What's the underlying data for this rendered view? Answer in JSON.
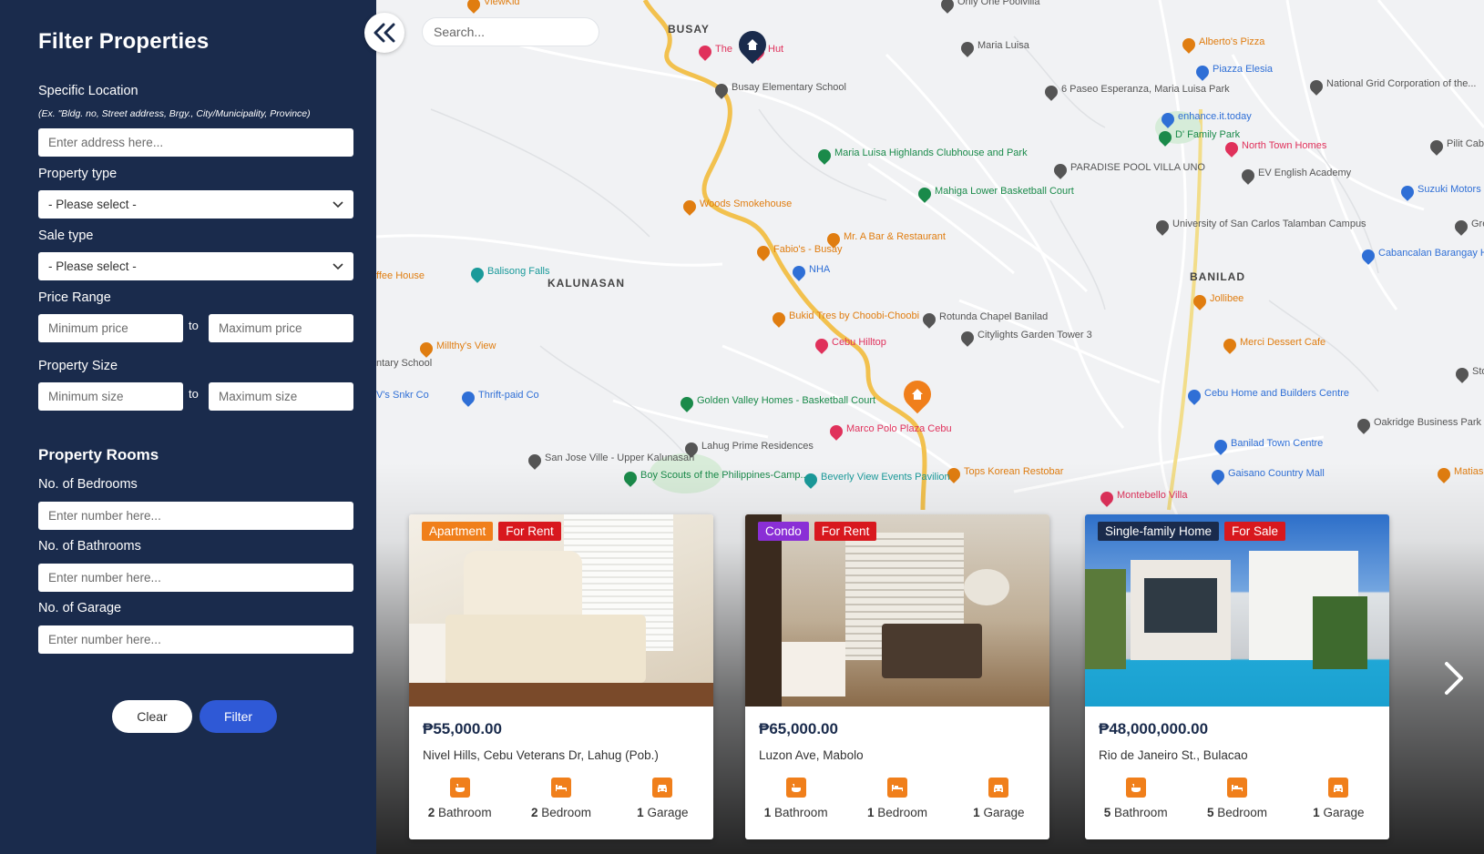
{
  "sidebar": {
    "title": "Filter Properties",
    "location": {
      "label": "Specific Location",
      "hint": "(Ex. \"Bldg. no, Street address, Brgy., City/Municipality, Province)",
      "placeholder": "Enter address here..."
    },
    "property_type": {
      "label": "Property type",
      "value": "- Please select -"
    },
    "sale_type": {
      "label": "Sale type",
      "value": "- Please select -"
    },
    "price_range": {
      "label": "Price Range",
      "min_placeholder": "Minimum price",
      "max_placeholder": "Maximum price",
      "to": "to"
    },
    "property_size": {
      "label": "Property Size",
      "min_placeholder": "Minimum size",
      "max_placeholder": "Maximum size",
      "to": "to"
    },
    "rooms_title": "Property Rooms",
    "bedrooms": {
      "label": "No. of Bedrooms",
      "placeholder": "Enter number here..."
    },
    "bathrooms": {
      "label": "No. of Bathrooms",
      "placeholder": "Enter number here..."
    },
    "garage": {
      "label": "No. of Garage",
      "placeholder": "Enter number here..."
    },
    "clear_label": "Clear",
    "filter_label": "Filter",
    "collapse_icon": "double-chevron-left-icon"
  },
  "search": {
    "placeholder": "Search..."
  },
  "map": {
    "areas": [
      "BUSAY",
      "KALUNASAN",
      "BANILAD"
    ],
    "pois": [
      {
        "label": "ViewKid",
        "color": "#e07d10"
      },
      {
        "label": "Only One Poolvilla",
        "color": "#555"
      },
      {
        "label": "The",
        "color": "#e0315b"
      },
      {
        "label": "Hut",
        "color": "#e0315b"
      },
      {
        "label": "Maria Luisa",
        "color": "#555"
      },
      {
        "label": "Busay Elementary School",
        "color": "#555"
      },
      {
        "label": "6 Paseo Esperanza, Maria Luisa Park",
        "color": "#555"
      },
      {
        "label": "Alberto's Pizza",
        "color": "#e07d10"
      },
      {
        "label": "Piazza Elesia",
        "color": "#2f6fd6"
      },
      {
        "label": "National Grid Corporation of the...",
        "color": "#555"
      },
      {
        "label": "enhance.it.today",
        "color": "#2f6fd6"
      },
      {
        "label": "D' Family Park",
        "color": "#1a8a4a"
      },
      {
        "label": "North Town Homes",
        "color": "#e0315b"
      },
      {
        "label": "Pilit Cab",
        "color": "#555"
      },
      {
        "label": "Maria Luisa Highlands Clubhouse and Park",
        "color": "#1a8a4a"
      },
      {
        "label": "PARADISE POOL VILLA UNO",
        "color": "#555"
      },
      {
        "label": "EV English Academy",
        "color": "#555"
      },
      {
        "label": "Suzuki Motors",
        "color": "#2f6fd6"
      },
      {
        "label": "Mahiga Lower Basketball Court",
        "color": "#1a8a4a"
      },
      {
        "label": "Woods Smokehouse",
        "color": "#e07d10"
      },
      {
        "label": "University of San Carlos Talamban Campus",
        "color": "#555"
      },
      {
        "label": "Greenhi",
        "color": "#555"
      },
      {
        "label": "Fabio's - Busay",
        "color": "#e07d10"
      },
      {
        "label": "Mr. A Bar & Restaurant",
        "color": "#e07d10"
      },
      {
        "label": "Cabancalan Barangay Hall",
        "color": "#2f6fd6"
      },
      {
        "label": "ffee House",
        "color": "#e07d10"
      },
      {
        "label": "Balisong Falls",
        "color": "#1a9a9a"
      },
      {
        "label": "NHA",
        "color": "#2f6fd6"
      },
      {
        "label": "Jollibee",
        "color": "#e07d10"
      },
      {
        "label": "Bukid Tres by Choobi-Choobi",
        "color": "#e07d10"
      },
      {
        "label": "Rotunda Chapel Banilad",
        "color": "#555"
      },
      {
        "label": "Millthy's View",
        "color": "#e07d10"
      },
      {
        "label": "Cebu Hilltop",
        "color": "#e0315b"
      },
      {
        "label": "Citylights Garden Tower 3",
        "color": "#555"
      },
      {
        "label": "Merci Dessert Cafe",
        "color": "#e07d10"
      },
      {
        "label": "ntary School",
        "color": "#555"
      },
      {
        "label": "Sto. Niño Village",
        "color": "#555"
      },
      {
        "label": "V's Snkr Co",
        "color": "#2f6fd6"
      },
      {
        "label": "Thrift-paid Co",
        "color": "#2f6fd6"
      },
      {
        "label": "Cebu Home and Builders Centre",
        "color": "#2f6fd6"
      },
      {
        "label": "Golden Valley Homes - Basketball Court",
        "color": "#1a8a4a"
      },
      {
        "label": "Marco Polo Plaza Cebu",
        "color": "#e0315b"
      },
      {
        "label": "Oakridge Business Park",
        "color": "#555"
      },
      {
        "label": "Lahug Prime Residences",
        "color": "#555"
      },
      {
        "label": "Banilad Town Centre",
        "color": "#2f6fd6"
      },
      {
        "label": "San Jose Ville - Upper Kalunasan",
        "color": "#555"
      },
      {
        "label": "Tops Korean Restobar",
        "color": "#e07d10"
      },
      {
        "label": "Gaisano Country Mall",
        "color": "#2f6fd6"
      },
      {
        "label": "Matias BBQ",
        "color": "#e07d10"
      },
      {
        "label": "Boy Scouts of the Philippines-Camp...",
        "color": "#1a8a4a"
      },
      {
        "label": "Beverly View Events Pavilion",
        "color": "#1a9a9a"
      },
      {
        "label": "Montebello Villa",
        "color": "#e0315b"
      }
    ]
  },
  "listings": [
    {
      "type": "Apartment",
      "type_color": "#f07f1b",
      "status": "For Rent",
      "status_color": "#d8181e",
      "price": "₱55,000.00",
      "address": "Nivel Hills, Cebu Veterans Dr, Lahug (Pob.)",
      "bath_count": "2",
      "bath_label": "Bathroom",
      "bed_count": "2",
      "bed_label": "Bedroom",
      "garage_count": "1",
      "garage_label": "Garage"
    },
    {
      "type": "Condo",
      "type_color": "#8a2fd6",
      "status": "For Rent",
      "status_color": "#d8181e",
      "price": "₱65,000.00",
      "address": "Luzon Ave, Mabolo",
      "bath_count": "1",
      "bath_label": "Bathroom",
      "bed_count": "1",
      "bed_label": "Bedroom",
      "garage_count": "1",
      "garage_label": "Garage"
    },
    {
      "type": "Single-family Home",
      "type_color": "#1a2b4c",
      "status": "For Sale",
      "status_color": "#d8181e",
      "price": "₱48,000,000.00",
      "address": "Rio de Janeiro St., Bulacao",
      "bath_count": "5",
      "bath_label": "Bathroom",
      "bed_count": "5",
      "bed_label": "Bedroom",
      "garage_count": "1",
      "garage_label": "Garage"
    }
  ],
  "colors": {
    "sidebar_bg": "#1a2b4c",
    "accent": "#2f59d6",
    "feature_icon": "#f07f1b"
  }
}
